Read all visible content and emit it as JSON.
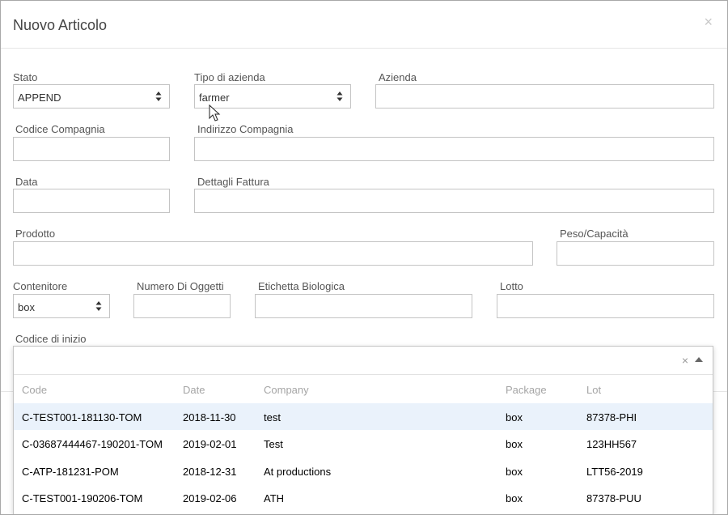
{
  "modal": {
    "title": "Nuovo Articolo",
    "close_icon": "×"
  },
  "form": {
    "stato": {
      "label": "Stato",
      "value": "APPEND"
    },
    "tipo_azienda": {
      "label": "Tipo di azienda",
      "value": "farmer"
    },
    "azienda": {
      "label": "Azienda",
      "value": ""
    },
    "codice_compagnia": {
      "label": "Codice Compagnia",
      "value": ""
    },
    "indirizzo_compagnia": {
      "label": "Indirizzo Compagnia",
      "value": ""
    },
    "data": {
      "label": "Data",
      "value": ""
    },
    "dettagli_fattura": {
      "label": "Dettagli Fattura",
      "value": ""
    },
    "prodotto": {
      "label": "Prodotto",
      "value": ""
    },
    "peso_capacita": {
      "label": "Peso/Capacità",
      "value": ""
    },
    "contenitore": {
      "label": "Contenitore",
      "value": "box"
    },
    "numero_oggetti": {
      "label": "Numero Di Oggetti",
      "value": ""
    },
    "etichetta_biologica": {
      "label": "Etichetta Biologica",
      "value": ""
    },
    "lotto": {
      "label": "Lotto",
      "value": ""
    },
    "codice_inizio": {
      "label": "Codice di inizio",
      "value": "",
      "clear_icon": "×"
    }
  },
  "dropdown": {
    "columns": {
      "code": "Code",
      "date": "Date",
      "company": "Company",
      "package": "Package",
      "lot": "Lot"
    },
    "rows": [
      {
        "code": "C-TEST001-181130-TOM",
        "date": "2018-11-30",
        "company": "test",
        "package": "box",
        "lot": "87378-PHI"
      },
      {
        "code": "C-03687444467-190201-TOM",
        "date": "2019-02-01",
        "company": "Test",
        "package": "box",
        "lot": "123HH567"
      },
      {
        "code": "C-ATP-181231-POM",
        "date": "2018-12-31",
        "company": "At productions",
        "package": "box",
        "lot": "LTT56-2019"
      },
      {
        "code": "C-TEST001-190206-TOM",
        "date": "2019-02-06",
        "company": "ATH",
        "package": "box",
        "lot": "87378-PUU"
      }
    ]
  },
  "colors": {
    "text": "#333333",
    "label": "#555555",
    "header_muted": "#a5a5a5",
    "border": "#c4c4c4",
    "active_row": "#eaf2fb"
  },
  "icons": {
    "select_arrows": "updown-arrows-icon",
    "dropdown_toggle": "caret-up-icon",
    "cursor": "mouse-pointer-icon"
  }
}
